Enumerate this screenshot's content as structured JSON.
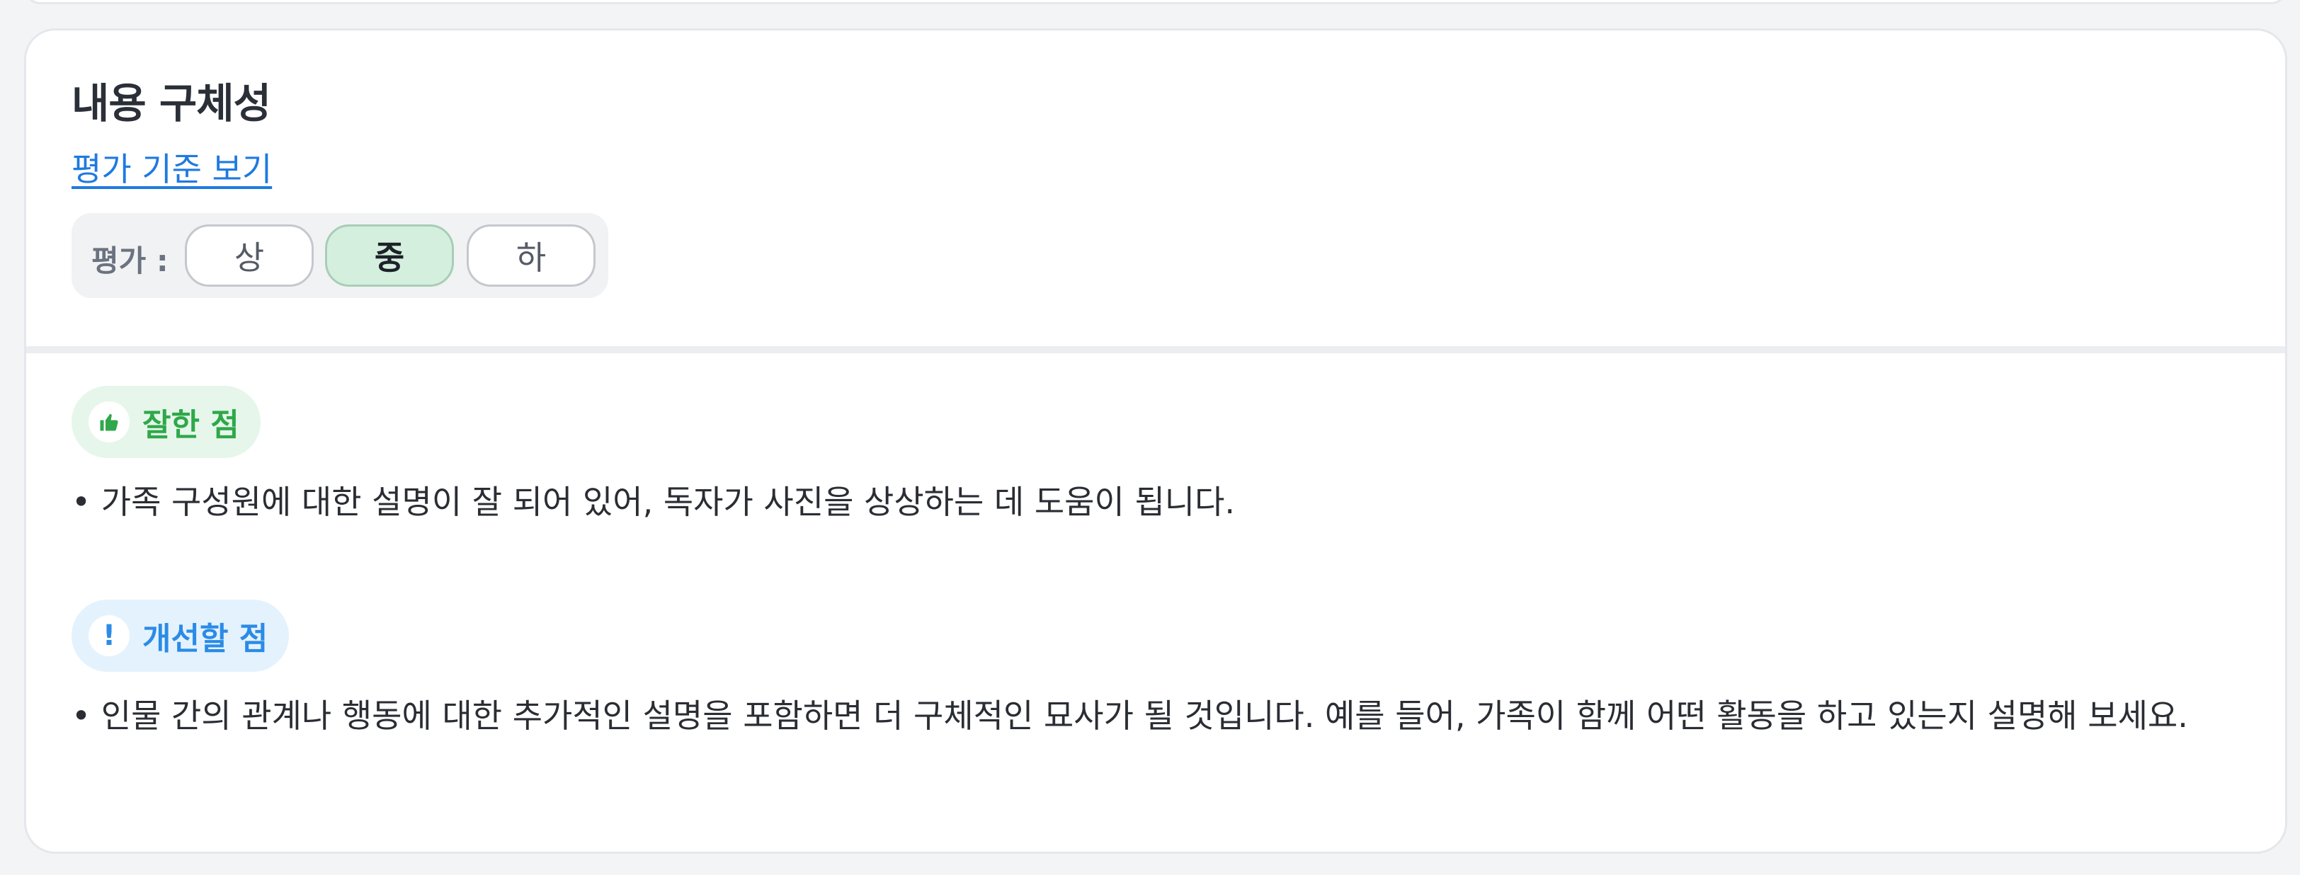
{
  "section": {
    "title": "내용 구체성",
    "criteria_link": "평가 기준 보기"
  },
  "rating": {
    "label": "평가 :",
    "options": [
      "상",
      "중",
      "하"
    ],
    "selected": "중"
  },
  "feedback": {
    "good": {
      "label": "잘한 점",
      "icon": "thumbs-up-icon",
      "color": "#2ea84a",
      "text": "• 가족 구성원에 대한 설명이 잘 되어 있어, 독자가 사진을 상상하는 데 도움이 됩니다."
    },
    "improve": {
      "label": "개선할 점",
      "icon": "exclamation-icon",
      "color": "#2b8be6",
      "text": "• 인물 간의 관계나 행동에 대한 추가적인 설명을 포함하면 더 구체적인 묘사가 될 것입니다. 예를 들어, 가족이 함께 어떤 활동을 하고 있는지 설명해 보세요."
    }
  },
  "colors": {
    "link": "#1f7ae0",
    "selected_bg": "#d5efdf"
  }
}
